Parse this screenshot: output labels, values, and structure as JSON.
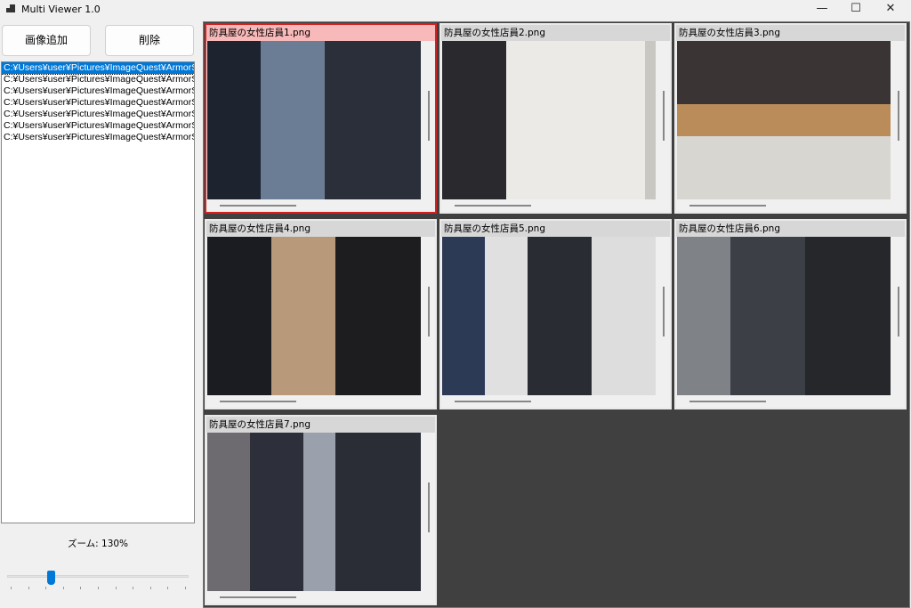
{
  "window": {
    "title": "Multi Viewer 1.0",
    "minimize": "—",
    "maximize": "☐",
    "close": "✕"
  },
  "toolbar": {
    "add_label": "画像追加",
    "delete_label": "削除"
  },
  "file_list": {
    "selected_index": 0,
    "items": [
      "C:¥Users¥user¥Pictures¥ImageQuest¥ArmorShop",
      "C:¥Users¥user¥Pictures¥ImageQuest¥ArmorShop",
      "C:¥Users¥user¥Pictures¥ImageQuest¥ArmorShop",
      "C:¥Users¥user¥Pictures¥ImageQuest¥ArmorShop",
      "C:¥Users¥user¥Pictures¥ImageQuest¥ArmorShop",
      "C:¥Users¥user¥Pictures¥ImageQuest¥ArmorShop",
      "C:¥Users¥user¥Pictures¥ImageQuest¥ArmorShop"
    ]
  },
  "zoom": {
    "label": "ズーム: 130%",
    "slider_fraction": 0.25,
    "accent": "#0078d7"
  },
  "tiles": [
    {
      "caption": "防具屋の女性店員1.png",
      "selected": true
    },
    {
      "caption": "防具屋の女性店員2.png"
    },
    {
      "caption": "防具屋の女性店員3.png"
    },
    {
      "caption": "防具屋の女性店員4.png"
    },
    {
      "caption": "防具屋の女性店員5.png"
    },
    {
      "caption": "防具屋の女性店員6.png"
    },
    {
      "caption": "防具屋の女性店員7.png"
    }
  ]
}
